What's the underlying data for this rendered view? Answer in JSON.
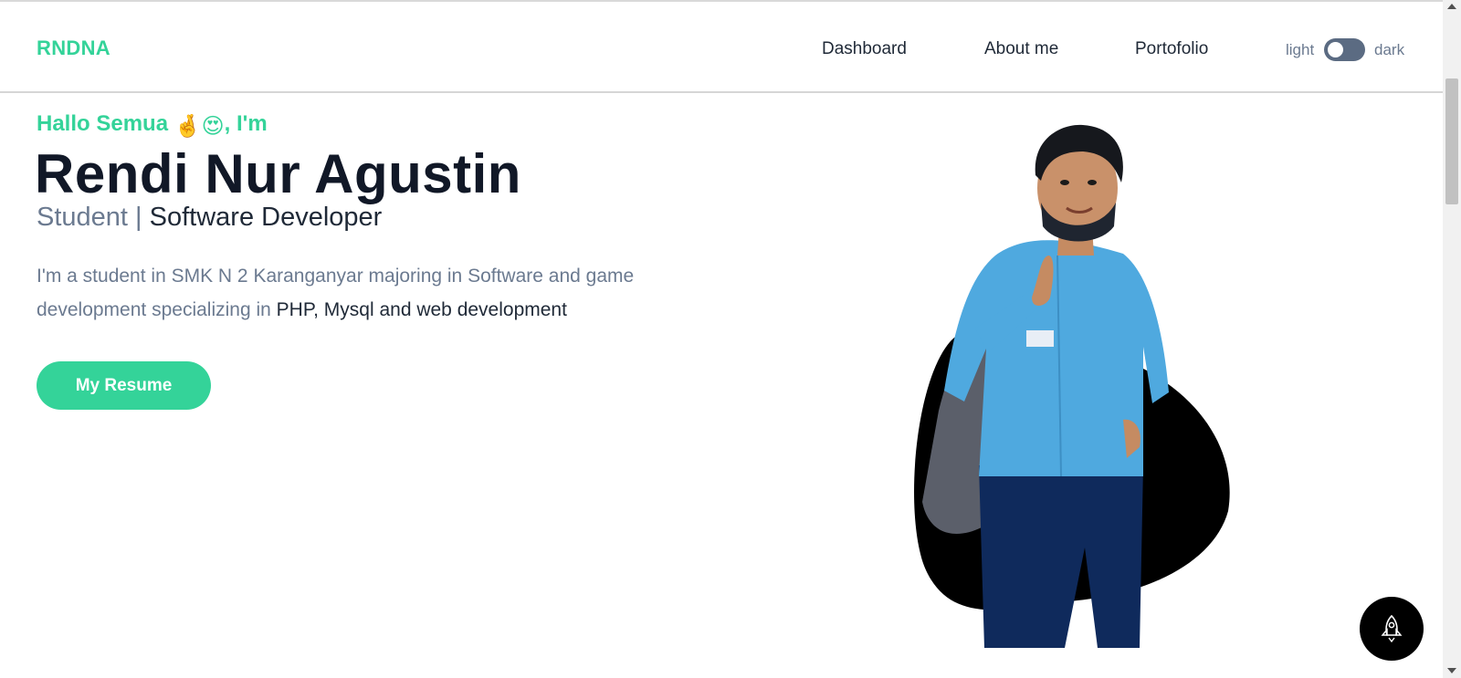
{
  "navbar": {
    "brand": "RNDNA",
    "links": [
      "Dashboard",
      "About me",
      "Portofolio"
    ],
    "theme_light": "light",
    "theme_dark": "dark",
    "theme_mode": "light"
  },
  "hero": {
    "greeting_before": "Hallo Semua ",
    "greeting_emoji": "🤞😍",
    "greeting_after": ", I'm",
    "name": "Rendi Nur Agustin",
    "role_prefix": "Student | ",
    "role_main": "Software Developer",
    "description_muted": "I'm a student in SMK N 2 Karanganyar majoring in Software and game development specializing in ",
    "description_highlight": "PHP, Mysql and web development",
    "resume_button": "My Resume"
  },
  "floating_button": {
    "icon": "rocket-icon"
  },
  "colors": {
    "accent": "#34d399",
    "heading": "#111827",
    "muted": "#6b7a90",
    "text": "#1f2937"
  }
}
